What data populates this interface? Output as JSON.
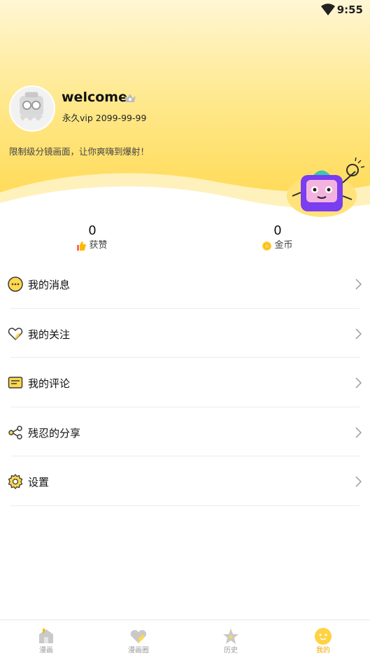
{
  "status_bar": {
    "time": "9:55",
    "wifi_icon": "wifi-icon"
  },
  "profile": {
    "username": "welcome",
    "vip_text": "永久vip 2099-99-99",
    "tagline": "限制级分镜画面，让你爽嗨到爆射！",
    "avatar_icon": "avatar-icon",
    "badge_icon": "vip-badge-icon"
  },
  "stats": {
    "likes": {
      "value": "0",
      "label": "获赞",
      "icon": "thumbs-up-icon"
    },
    "coins": {
      "value": "0",
      "label": "金币",
      "icon": "coin-icon"
    }
  },
  "menu": [
    {
      "label": "我的消息",
      "icon": "message-icon"
    },
    {
      "label": "我的关注",
      "icon": "heart-icon"
    },
    {
      "label": "我的评论",
      "icon": "comment-icon"
    },
    {
      "label": "残忍的分享",
      "icon": "share-icon"
    },
    {
      "label": "设置",
      "icon": "gear-icon"
    }
  ],
  "tabs": [
    {
      "label": "漫画",
      "icon": "home-icon",
      "active": false
    },
    {
      "label": "漫画圈",
      "icon": "heart-tab-icon",
      "active": false
    },
    {
      "label": "历史",
      "icon": "star-icon",
      "active": false
    },
    {
      "label": "我的",
      "icon": "face-icon",
      "active": true
    }
  ],
  "colors": {
    "accent": "#f5b800",
    "header_top": "#fff6d4",
    "header_bottom": "#ffd84d",
    "mascot_purple": "#7a3df0"
  }
}
